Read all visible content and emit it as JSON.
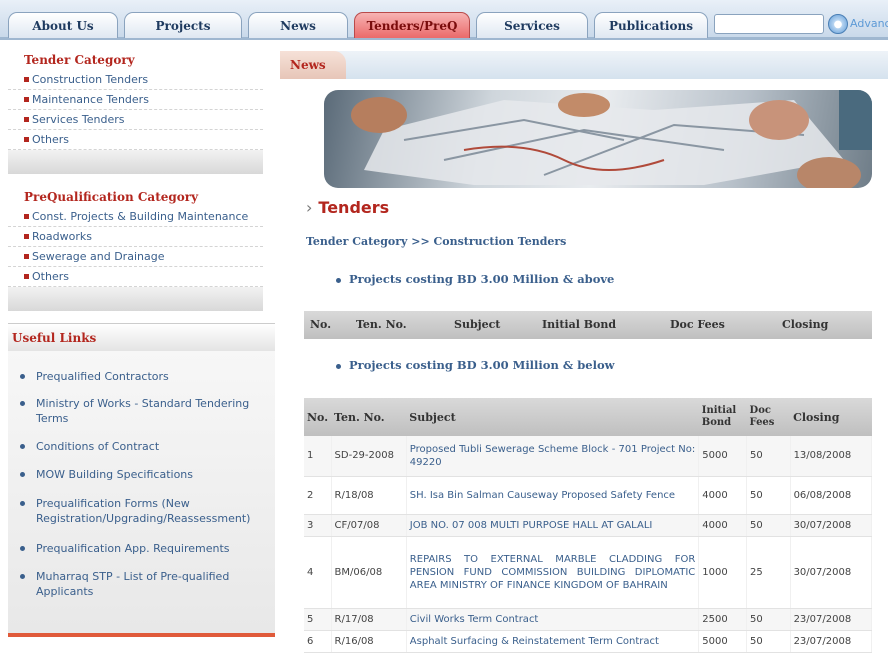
{
  "nav": {
    "tabs": [
      "About Us",
      "Projects",
      "News",
      "Tenders/PreQ",
      "Services",
      "Publications"
    ],
    "search_placeholder": "",
    "advanced_label": "Advanced"
  },
  "sidebar": {
    "tender_category": {
      "title": "Tender Category",
      "items": [
        "Construction Tenders",
        "Maintenance Tenders",
        "Services Tenders",
        "Others"
      ]
    },
    "preq_category": {
      "title": "PreQualification Category",
      "items": [
        "Const. Projects & Building Maintenance",
        "Roadworks",
        "Sewerage and Drainage",
        "Others"
      ]
    },
    "useful_links": {
      "title": "Useful Links",
      "items": [
        "Prequalified Contractors",
        "Ministry of Works - Standard Tendering Terms",
        "Conditions of Contract",
        "MOW Building Specifications",
        "Prequalification Forms (New Registration/Upgrading/Reassessment)",
        "Prequalification App. Requirements",
        "Muharraq STP - List of Pre-qualified Applicants"
      ]
    }
  },
  "main": {
    "news_tab": "News",
    "heading": "Tenders",
    "breadcrumb": "Tender Category >> Construction Tenders",
    "section_above": "Projects costing BD 3.00 Million & above",
    "section_below": "Projects costing BD 3.00 Million & below",
    "above_headers": [
      "No.",
      "Ten. No.",
      "Subject",
      "Initial Bond",
      "Doc Fees",
      "Closing"
    ],
    "below_headers": [
      "No.",
      "Ten. No.",
      "Subject",
      "Initial Bond",
      "Doc Fees",
      "Closing"
    ],
    "rows": [
      {
        "no": "1",
        "ten": "SD-29-2008",
        "subject": "Proposed Tubli Sewerage Scheme Block - 701 Project No: 49220",
        "bond": "5000",
        "fees": "50",
        "closing": "13/08/2008"
      },
      {
        "no": "2",
        "ten": "R/18/08",
        "subject": "SH. Isa Bin Salman Causeway Proposed Safety Fence",
        "bond": "4000",
        "fees": "50",
        "closing": "06/08/2008"
      },
      {
        "no": "3",
        "ten": "CF/07/08",
        "subject": "JOB NO. 07 008 MULTI PURPOSE HALL AT GALALI",
        "bond": "4000",
        "fees": "50",
        "closing": "30/07/2008"
      },
      {
        "no": "4",
        "ten": "BM/06/08",
        "subject": "REPAIRS TO EXTERNAL MARBLE CLADDING FOR PENSION FUND COMMISSION BUILDING DIPLOMATIC AREA MINISTRY OF FINANCE KINGDOM OF BAHRAIN",
        "bond": "1000",
        "fees": "25",
        "closing": "30/07/2008"
      },
      {
        "no": "5",
        "ten": "R/17/08",
        "subject": "Civil Works Term Contract",
        "bond": "2500",
        "fees": "50",
        "closing": "23/07/2008"
      },
      {
        "no": "6",
        "ten": "R/16/08",
        "subject": "Asphalt Surfacing & Reinstatement Term Contract",
        "bond": "5000",
        "fees": "50",
        "closing": "23/07/2008"
      }
    ]
  }
}
